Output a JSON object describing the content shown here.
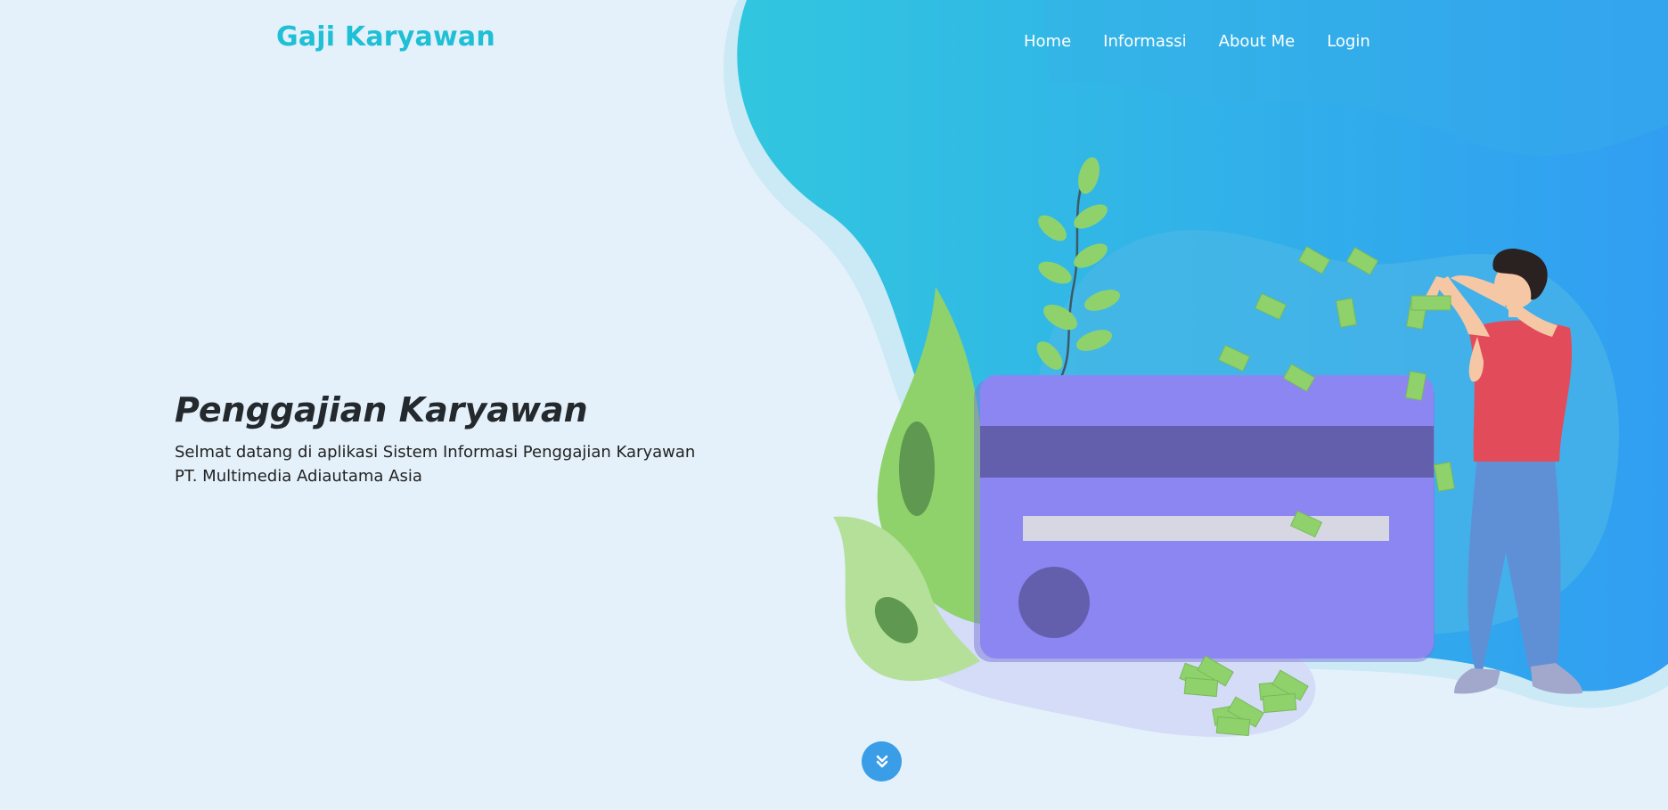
{
  "brand": {
    "name": "Gaji Karyawan"
  },
  "nav": {
    "items": [
      "Home",
      "Informassi",
      "About Me",
      "Login"
    ]
  },
  "hero": {
    "title": "Penggajian Karyawan",
    "description_line1": "Selmat datang di aplikasi Sistem Informasi Penggajian Karyawan",
    "description_line2": "PT. Multimedia Adiautama Asia"
  },
  "scroll_button": {
    "icon": "double-chevron-down-icon"
  },
  "colors": {
    "background": "#e4f1fa",
    "brand": "#1fbfd6",
    "blob_start": "#31c6df",
    "blob_end": "#319ef2",
    "card": "#8c86f2",
    "card_stripe": "#635fad",
    "shirt": "#e24c5a",
    "pants": "#5f90d6",
    "leaf": "#8fd26c",
    "scroll_button": "#3a9de8"
  }
}
